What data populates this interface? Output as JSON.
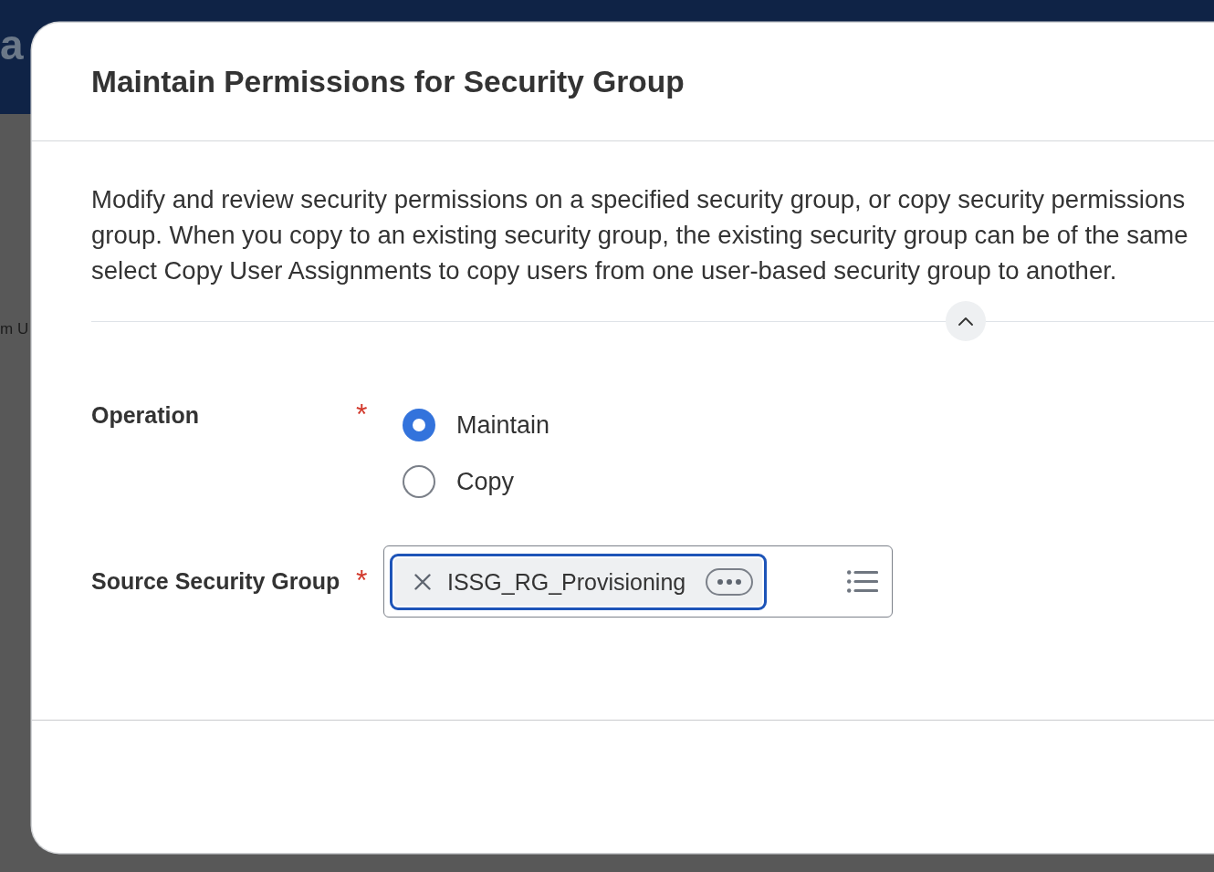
{
  "background": {
    "header_text": "a",
    "body_text": "m U"
  },
  "dialog": {
    "title": "Maintain Permissions for Security Group",
    "description": {
      "expanded": true,
      "lines": [
        "Modify and review security permissions on a specified security group, or copy security permissions",
        "group. When you copy to an existing security group, the existing security group can be of the same",
        "select Copy User Assignments to copy users from one user-based security group to another."
      ]
    },
    "fields": [
      {
        "kind": "radio_group",
        "label": "Operation",
        "required_mark": "*",
        "options": [
          {
            "label": "Maintain",
            "selected": true
          },
          {
            "label": "Copy",
            "selected": false
          }
        ]
      },
      {
        "kind": "prompt",
        "label": "Source Security Group",
        "required_mark": "*",
        "values": [
          {
            "text": "ISSG_RG_Provisioning",
            "focused": true
          }
        ]
      }
    ]
  }
}
